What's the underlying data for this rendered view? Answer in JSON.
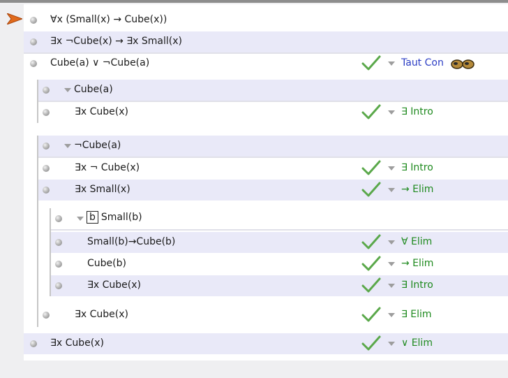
{
  "premises": [
    {
      "text": "∀x (Small(x) → Cube(x))"
    },
    {
      "text": "∃x ¬Cube(x) → ∃x Small(x)"
    }
  ],
  "proof": {
    "line3": {
      "text": "Cube(a) ∨ ¬Cube(a)",
      "rule": "Taut Con"
    },
    "sub1": {
      "assumption": "Cube(a)",
      "line": {
        "text": "∃x Cube(x)",
        "rule": "∃ Intro"
      }
    },
    "sub2": {
      "assumption": "¬Cube(a)",
      "line1": {
        "text": "∃x ¬ Cube(x)",
        "rule": "∃ Intro"
      },
      "line2": {
        "text": "∃x Small(x)",
        "rule": "→ Elim"
      },
      "inner": {
        "boxed_constant": "b",
        "assumption": "Small(b)",
        "line1": {
          "text": "Small(b)→Cube(b)",
          "rule": "∀ Elim"
        },
        "line2": {
          "text": "Cube(b)",
          "rule": "→ Elim"
        },
        "line3": {
          "text": "∃x Cube(x)",
          "rule": "∃ Intro"
        }
      },
      "line3": {
        "text": "∃x Cube(x)",
        "rule": "∃ Elim"
      }
    },
    "conclusion": {
      "text": "∃x Cube(x)",
      "rule": "∨ Elim"
    }
  },
  "colors": {
    "rule_green": "#1f8a1f",
    "rule_blue": "#2a3cc4",
    "row_shade": "#e9e9f8",
    "check_green": "#5aa84a",
    "pointer": "#e06a1c"
  },
  "icons": {
    "step_pointer": "arrow-pointer-icon",
    "check": "check-icon",
    "bullet": "bullet-icon",
    "collapse": "triangle-down-icon",
    "taut_con": "glasses-icon"
  }
}
